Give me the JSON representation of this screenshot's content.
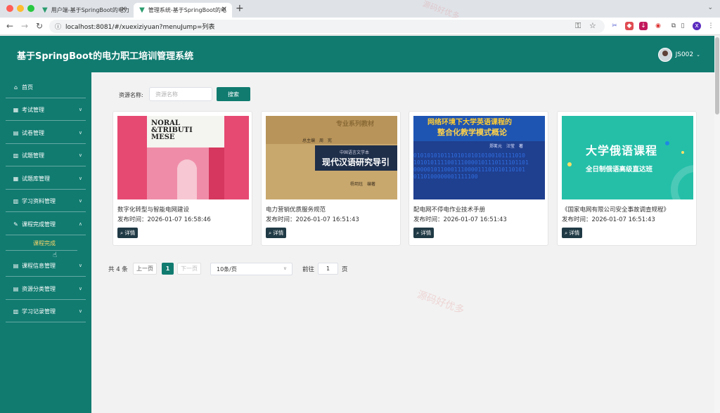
{
  "browser": {
    "tabs": [
      {
        "label": "用户端-基于SpringBoot的电力"
      },
      {
        "label": "管理系统-基于SpringBoot的电"
      }
    ],
    "url": "localhost:8081/#/xuexiziyuan?menuJump=列表",
    "profile_initial": "x"
  },
  "header": {
    "title": "基于SpringBoot的电力职工培训管理系统",
    "username": "JS002"
  },
  "sidebar": {
    "items": [
      {
        "label": "首页",
        "icon": "home-icon"
      },
      {
        "label": "考试管理",
        "icon": "exam-icon"
      },
      {
        "label": "试卷管理",
        "icon": "paper-icon"
      },
      {
        "label": "试题管理",
        "icon": "question-icon"
      },
      {
        "label": "试题库管理",
        "icon": "bank-icon"
      },
      {
        "label": "学习资料管理",
        "icon": "material-icon"
      },
      {
        "label": "课程完成管理",
        "icon": "course-complete-icon"
      },
      {
        "label": "课程信息管理",
        "icon": "course-info-icon"
      },
      {
        "label": "资源分类管理",
        "icon": "category-icon"
      },
      {
        "label": "学习记录管理",
        "icon": "record-icon"
      }
    ],
    "submenu_active": "课程完成"
  },
  "search": {
    "label": "资源名称:",
    "placeholder": "资源名称",
    "button": "搜索"
  },
  "cards": [
    {
      "title": "数字化转型与智能电网建设",
      "time": "发布时间：2026-01-07 16:58:46",
      "detail": "详情",
      "cover": {
        "m": "NORAL\n&TRIBUTI\nMESE",
        "r": ""
      }
    },
    {
      "title": "电力营销优质服务规范",
      "time": "发布时间：2026-01-07 16:51:43",
      "detail": "详情",
      "cover": {
        "t1": "专业系列教材",
        "t2": "总主编　周　宪",
        "s": "中国语言文学本",
        "b": "现代汉语研究导引",
        "t3": "杨玥珏　编著"
      }
    },
    {
      "title": "配电网不停电作业技术手册",
      "time": "发布时间：2026-01-07 16:51:43",
      "detail": "详情",
      "cover": {
        "a": "网络环境下大学英语课程的",
        "b": "整合化教学模式概论",
        "auth": "郑茗元　汪莹　著",
        "bin": [
          "010101010111010101010100101111010",
          "1010101111001110000101110111101101",
          "000001011000111000011101010110101",
          "0110100000001111100"
        ]
      }
    },
    {
      "title": "《国家电网有限公司安全事故调查规程》",
      "time": "发布时间：2026-01-07 16:51:43",
      "detail": "详情",
      "cover": {
        "t1": "大学俄语课程",
        "t2": "全日制俄语高级直达班"
      }
    }
  ],
  "pagination": {
    "total": "共 4 条",
    "prev": "上一页",
    "current": "1",
    "next": "下一页",
    "page_size": "10条/页",
    "goto_label": "前往",
    "goto_value": "1",
    "goto_unit": "页"
  },
  "watermark": "源码好优多",
  "colors": {
    "primary": "#117b70",
    "active_submenu": "#f6d56a",
    "detail_button": "#203a45"
  }
}
